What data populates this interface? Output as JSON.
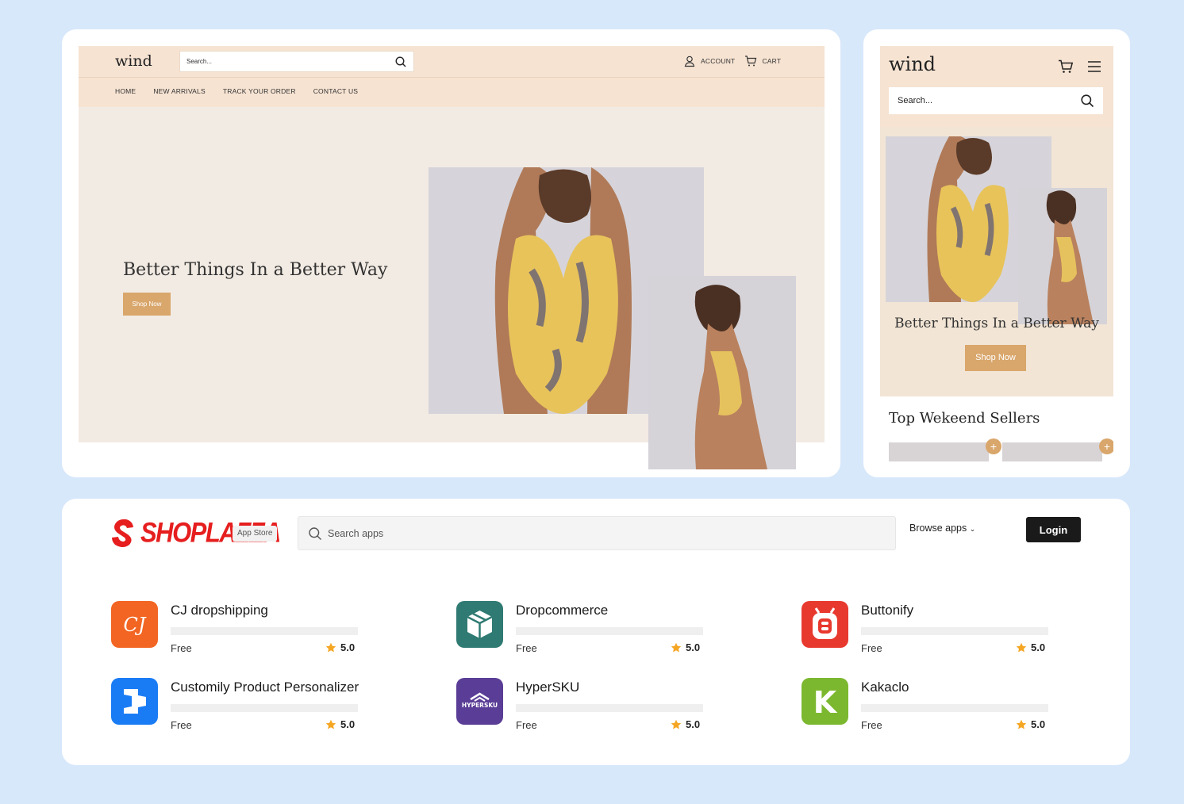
{
  "desktop": {
    "logo": "wind",
    "search_placeholder": "Search...",
    "account_label": "ACCOUNT",
    "cart_label": "CART",
    "nav": [
      "HOME",
      "NEW ARRIVALS",
      "TRACK YOUR ORDER",
      "CONTACT US"
    ],
    "hero_title": "Better Things In a Better Way",
    "shop_button": "Shop Now"
  },
  "mobile": {
    "logo": "wind",
    "search_placeholder": "Search...",
    "hero_title": "Better Things In a Better Way",
    "shop_button": "Shop Now",
    "section_title": "Top Wekeend Sellers"
  },
  "store": {
    "brand": "SHOPLAZZA",
    "badge": "App Store",
    "search_placeholder": "Search apps",
    "browse_label": "Browse apps",
    "login_label": "Login",
    "apps": [
      {
        "name": "CJ dropshipping",
        "price": "Free",
        "rating": "5.0",
        "icon": "cj-dropshipping-icon",
        "color": "#f26522"
      },
      {
        "name": "Dropcommerce",
        "price": "Free",
        "rating": "5.0",
        "icon": "dropcommerce-icon",
        "color": "#2f7a72"
      },
      {
        "name": "Buttonify",
        "price": "Free",
        "rating": "5.0",
        "icon": "buttonify-icon",
        "color": "#e8392f"
      },
      {
        "name": "Customily Product Personalizer",
        "price": "Free",
        "rating": "5.0",
        "icon": "customily-icon",
        "color": "#1a7cf5"
      },
      {
        "name": "HyperSKU",
        "price": "Free",
        "rating": "5.0",
        "icon": "hypersku-icon",
        "color": "#5a3d96",
        "icon_text": "HYPERSKU"
      },
      {
        "name": "Kakaclo",
        "price": "Free",
        "rating": "5.0",
        "icon": "kakaclo-icon",
        "color": "#7cb82f",
        "icon_text": "K"
      }
    ]
  },
  "colors": {
    "page_bg": "#d8e8fb",
    "header_bg": "#f6e3d2",
    "hero_bg": "#f2ebe3",
    "accent": "#d9a66b",
    "brand_red": "#e61e1e",
    "star": "#f5a623"
  }
}
